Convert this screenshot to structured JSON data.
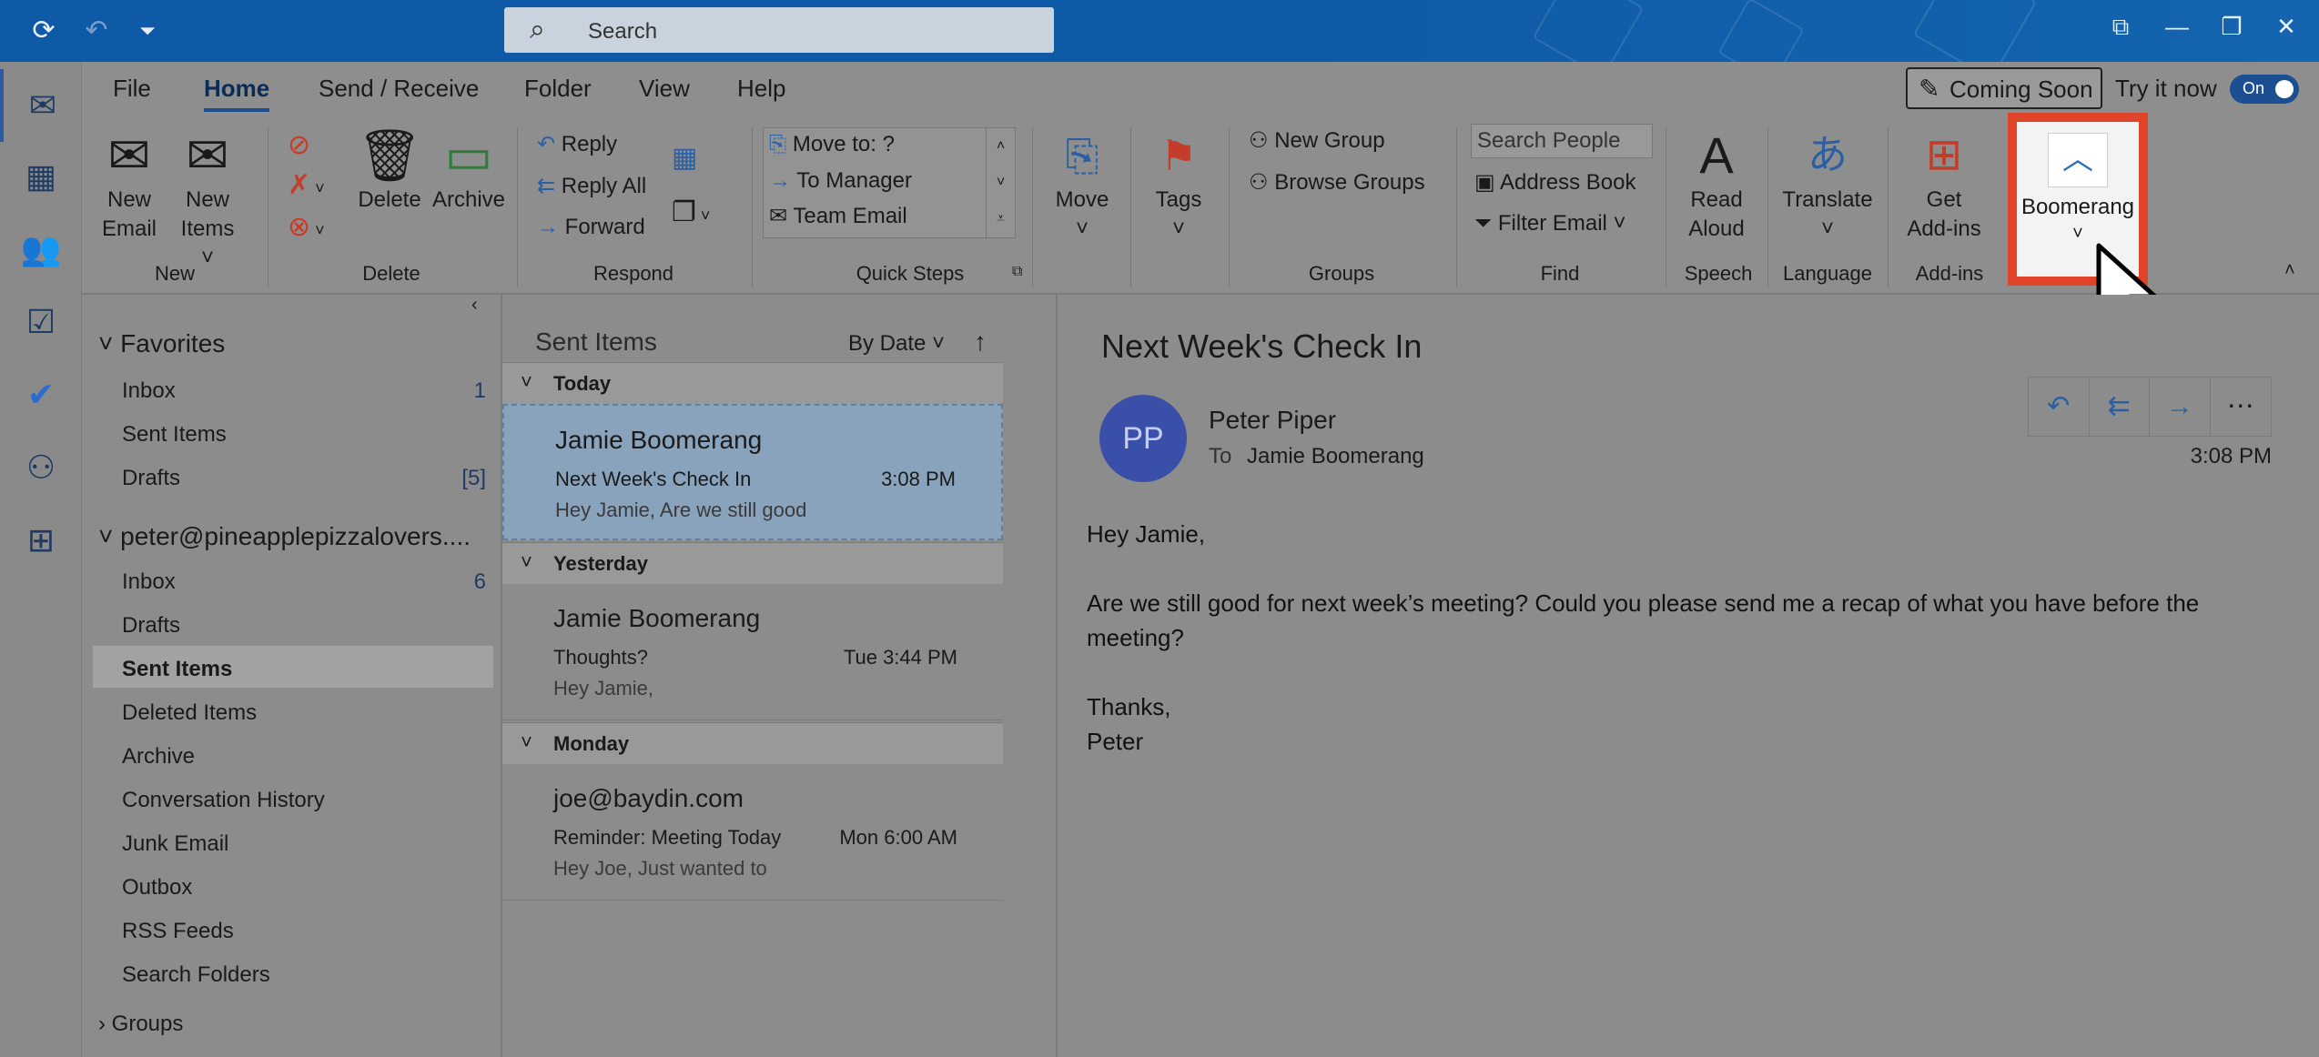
{
  "titlebar": {
    "search_placeholder": "Search"
  },
  "tabs": [
    {
      "label": "File"
    },
    {
      "label": "Home"
    },
    {
      "label": "Send / Receive"
    },
    {
      "label": "Folder"
    },
    {
      "label": "View"
    },
    {
      "label": "Help"
    }
  ],
  "header_right": {
    "coming_soon": "Coming Soon",
    "try_it": "Try it now",
    "toggle": "On"
  },
  "ribbon": {
    "new": {
      "new_email": [
        "New",
        "Email"
      ],
      "new_items": [
        "New",
        "Items"
      ],
      "group": "New"
    },
    "delete": {
      "delete": "Delete",
      "archive": "Archive",
      "group": "Delete"
    },
    "respond": {
      "reply": "Reply",
      "reply_all": "Reply All",
      "forward": "Forward",
      "group": "Respond"
    },
    "quick_steps": {
      "items": [
        "Move to: ?",
        "To Manager",
        "Team Email"
      ],
      "group": "Quick Steps"
    },
    "move": {
      "label": "Move"
    },
    "tags": {
      "label": "Tags"
    },
    "groups": {
      "new_group": "New Group",
      "browse_groups": "Browse Groups",
      "group": "Groups"
    },
    "find": {
      "search_people": "Search People",
      "address_book": "Address Book",
      "filter_email": "Filter Email",
      "group": "Find"
    },
    "speech": {
      "read_aloud": [
        "Read",
        "Aloud"
      ],
      "group": "Speech"
    },
    "language": {
      "translate": "Translate",
      "group": "Language"
    },
    "addins": {
      "get_addins": [
        "Get",
        "Add-ins"
      ],
      "group": "Add-ins"
    },
    "boomerang": {
      "label": "Boomerang"
    }
  },
  "folders": {
    "favorites_label": "Favorites",
    "favorites": [
      {
        "name": "Inbox",
        "count": "1"
      },
      {
        "name": "Sent Items",
        "count": ""
      },
      {
        "name": "Drafts",
        "count": "[5]"
      }
    ],
    "account_label": "peter@pineapplepizzalovers....",
    "account": [
      {
        "name": "Inbox",
        "count": "6"
      },
      {
        "name": "Drafts",
        "count": ""
      },
      {
        "name": "Sent Items",
        "count": ""
      },
      {
        "name": "Deleted Items",
        "count": ""
      },
      {
        "name": "Archive",
        "count": ""
      },
      {
        "name": "Conversation History",
        "count": ""
      },
      {
        "name": "Junk Email",
        "count": ""
      },
      {
        "name": "Outbox",
        "count": ""
      },
      {
        "name": "RSS Feeds",
        "count": ""
      },
      {
        "name": "Search Folders",
        "count": ""
      }
    ],
    "groups_label": "Groups"
  },
  "message_list": {
    "header": "Sent Items",
    "sort": "By Date",
    "groups": [
      {
        "label": "Today",
        "messages": [
          {
            "from": "Jamie Boomerang",
            "subject": "Next Week's Check In",
            "time": "3:08 PM",
            "preview": "Hey Jamie,  Are we still good"
          }
        ]
      },
      {
        "label": "Yesterday",
        "messages": [
          {
            "from": "Jamie Boomerang",
            "subject": "Thoughts?",
            "time": "Tue 3:44 PM",
            "preview": "Hey Jamie,"
          }
        ]
      },
      {
        "label": "Monday",
        "messages": [
          {
            "from": "joe@baydin.com",
            "subject": "Reminder: Meeting Today",
            "time": "Mon 6:00 AM",
            "preview": "Hey Joe,  Just wanted to"
          }
        ]
      }
    ]
  },
  "reading": {
    "subject": "Next Week's Check In",
    "avatar": "PP",
    "from": "Peter Piper",
    "to_label": "To",
    "to": "Jamie Boomerang",
    "time": "3:08 PM",
    "body": [
      "Hey Jamie,",
      "Are we still good for next week’s meeting? Could you please send me a recap of what you have before the",
      "meeting?",
      "Thanks,",
      "Peter"
    ]
  },
  "colors": {
    "titlebar": "#0f5aa6",
    "highlight_box": "#e0452a",
    "avatar": "#3a4fa8"
  }
}
